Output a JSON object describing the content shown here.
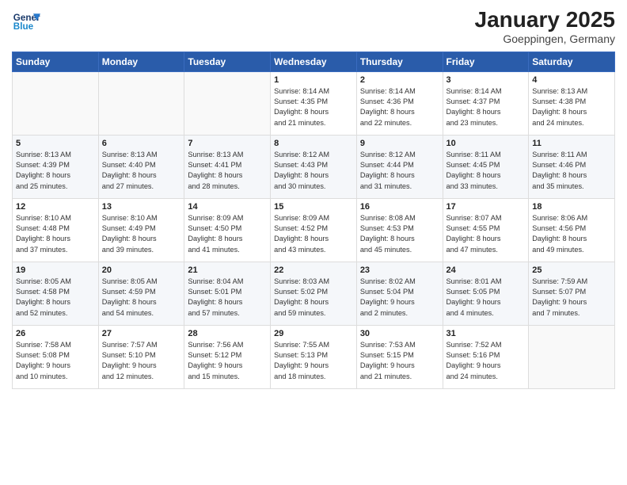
{
  "header": {
    "logo_line1": "General",
    "logo_line2": "Blue",
    "title": "January 2025",
    "subtitle": "Goeppingen, Germany"
  },
  "weekdays": [
    "Sunday",
    "Monday",
    "Tuesday",
    "Wednesday",
    "Thursday",
    "Friday",
    "Saturday"
  ],
  "weeks": [
    [
      {
        "day": "",
        "info": ""
      },
      {
        "day": "",
        "info": ""
      },
      {
        "day": "",
        "info": ""
      },
      {
        "day": "1",
        "info": "Sunrise: 8:14 AM\nSunset: 4:35 PM\nDaylight: 8 hours\nand 21 minutes."
      },
      {
        "day": "2",
        "info": "Sunrise: 8:14 AM\nSunset: 4:36 PM\nDaylight: 8 hours\nand 22 minutes."
      },
      {
        "day": "3",
        "info": "Sunrise: 8:14 AM\nSunset: 4:37 PM\nDaylight: 8 hours\nand 23 minutes."
      },
      {
        "day": "4",
        "info": "Sunrise: 8:13 AM\nSunset: 4:38 PM\nDaylight: 8 hours\nand 24 minutes."
      }
    ],
    [
      {
        "day": "5",
        "info": "Sunrise: 8:13 AM\nSunset: 4:39 PM\nDaylight: 8 hours\nand 25 minutes."
      },
      {
        "day": "6",
        "info": "Sunrise: 8:13 AM\nSunset: 4:40 PM\nDaylight: 8 hours\nand 27 minutes."
      },
      {
        "day": "7",
        "info": "Sunrise: 8:13 AM\nSunset: 4:41 PM\nDaylight: 8 hours\nand 28 minutes."
      },
      {
        "day": "8",
        "info": "Sunrise: 8:12 AM\nSunset: 4:43 PM\nDaylight: 8 hours\nand 30 minutes."
      },
      {
        "day": "9",
        "info": "Sunrise: 8:12 AM\nSunset: 4:44 PM\nDaylight: 8 hours\nand 31 minutes."
      },
      {
        "day": "10",
        "info": "Sunrise: 8:11 AM\nSunset: 4:45 PM\nDaylight: 8 hours\nand 33 minutes."
      },
      {
        "day": "11",
        "info": "Sunrise: 8:11 AM\nSunset: 4:46 PM\nDaylight: 8 hours\nand 35 minutes."
      }
    ],
    [
      {
        "day": "12",
        "info": "Sunrise: 8:10 AM\nSunset: 4:48 PM\nDaylight: 8 hours\nand 37 minutes."
      },
      {
        "day": "13",
        "info": "Sunrise: 8:10 AM\nSunset: 4:49 PM\nDaylight: 8 hours\nand 39 minutes."
      },
      {
        "day": "14",
        "info": "Sunrise: 8:09 AM\nSunset: 4:50 PM\nDaylight: 8 hours\nand 41 minutes."
      },
      {
        "day": "15",
        "info": "Sunrise: 8:09 AM\nSunset: 4:52 PM\nDaylight: 8 hours\nand 43 minutes."
      },
      {
        "day": "16",
        "info": "Sunrise: 8:08 AM\nSunset: 4:53 PM\nDaylight: 8 hours\nand 45 minutes."
      },
      {
        "day": "17",
        "info": "Sunrise: 8:07 AM\nSunset: 4:55 PM\nDaylight: 8 hours\nand 47 minutes."
      },
      {
        "day": "18",
        "info": "Sunrise: 8:06 AM\nSunset: 4:56 PM\nDaylight: 8 hours\nand 49 minutes."
      }
    ],
    [
      {
        "day": "19",
        "info": "Sunrise: 8:05 AM\nSunset: 4:58 PM\nDaylight: 8 hours\nand 52 minutes."
      },
      {
        "day": "20",
        "info": "Sunrise: 8:05 AM\nSunset: 4:59 PM\nDaylight: 8 hours\nand 54 minutes."
      },
      {
        "day": "21",
        "info": "Sunrise: 8:04 AM\nSunset: 5:01 PM\nDaylight: 8 hours\nand 57 minutes."
      },
      {
        "day": "22",
        "info": "Sunrise: 8:03 AM\nSunset: 5:02 PM\nDaylight: 8 hours\nand 59 minutes."
      },
      {
        "day": "23",
        "info": "Sunrise: 8:02 AM\nSunset: 5:04 PM\nDaylight: 9 hours\nand 2 minutes."
      },
      {
        "day": "24",
        "info": "Sunrise: 8:01 AM\nSunset: 5:05 PM\nDaylight: 9 hours\nand 4 minutes."
      },
      {
        "day": "25",
        "info": "Sunrise: 7:59 AM\nSunset: 5:07 PM\nDaylight: 9 hours\nand 7 minutes."
      }
    ],
    [
      {
        "day": "26",
        "info": "Sunrise: 7:58 AM\nSunset: 5:08 PM\nDaylight: 9 hours\nand 10 minutes."
      },
      {
        "day": "27",
        "info": "Sunrise: 7:57 AM\nSunset: 5:10 PM\nDaylight: 9 hours\nand 12 minutes."
      },
      {
        "day": "28",
        "info": "Sunrise: 7:56 AM\nSunset: 5:12 PM\nDaylight: 9 hours\nand 15 minutes."
      },
      {
        "day": "29",
        "info": "Sunrise: 7:55 AM\nSunset: 5:13 PM\nDaylight: 9 hours\nand 18 minutes."
      },
      {
        "day": "30",
        "info": "Sunrise: 7:53 AM\nSunset: 5:15 PM\nDaylight: 9 hours\nand 21 minutes."
      },
      {
        "day": "31",
        "info": "Sunrise: 7:52 AM\nSunset: 5:16 PM\nDaylight: 9 hours\nand 24 minutes."
      },
      {
        "day": "",
        "info": ""
      }
    ]
  ]
}
